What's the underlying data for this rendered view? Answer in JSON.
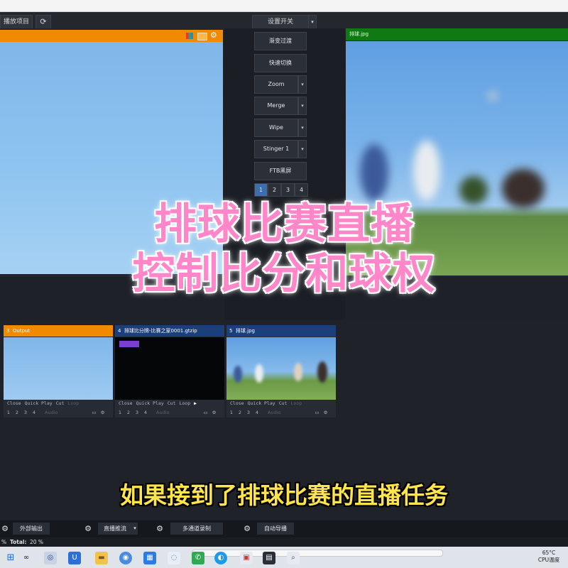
{
  "toolbar": {
    "left_label": "播放项目",
    "refresh_icon": "refresh-icon",
    "center_select": "设置开关",
    "dropdown_icon": "chevron-down-icon"
  },
  "preview": {
    "icons": [
      "color-bars-icon",
      "grid-icon",
      "gear-icon"
    ]
  },
  "transitions": {
    "buttons": [
      {
        "label": "渐变过渡",
        "has_dropdown": false
      },
      {
        "label": "快速切换",
        "has_dropdown": false
      },
      {
        "label": "Zoom",
        "has_dropdown": true
      },
      {
        "label": "Merge",
        "has_dropdown": true
      },
      {
        "label": "Wipe",
        "has_dropdown": true
      },
      {
        "label": "Stinger 1",
        "has_dropdown": true
      },
      {
        "label": "FTB黑屏",
        "has_dropdown": false
      }
    ],
    "pages": [
      "1",
      "2",
      "3",
      "4"
    ],
    "active_page": "1"
  },
  "program": {
    "header": "排球.jpg"
  },
  "overlay": {
    "title_line1": "排球比赛直播",
    "title_line2": "控制比分和球权",
    "subtitle": "如果接到了排球比赛的直播任务"
  },
  "inputs": [
    {
      "number": "3",
      "name": "Output",
      "header_color": "#f28a00"
    },
    {
      "number": "4",
      "name": "排球比分牌-比赛之家0001.gtzip",
      "header_color": "#1b3f7a"
    },
    {
      "number": "5",
      "name": "排球.jpg",
      "header_color": "#1b3f7a"
    }
  ],
  "input_controls": {
    "labels": [
      "Close",
      "Quick Play",
      "Cut",
      "Loop"
    ],
    "numbers": [
      "1",
      "2",
      "3",
      "4"
    ],
    "audio_label": "Audio"
  },
  "bottom_bar": {
    "buttons": [
      "外部输出",
      "直播推流",
      "多通道录制",
      "自动导播"
    ]
  },
  "status": {
    "left_value": "%",
    "total_label": "Total:",
    "total_value": "20 %",
    "temp": "65°C",
    "temp_label": "CPU温度"
  },
  "taskbar": {
    "icons": [
      "windows-icon",
      "search-icon",
      "task-view-icon",
      "app-u-icon",
      "file-explorer-icon",
      "chrome-icon",
      "vmix-icon",
      "wechat-icon",
      "app-icon",
      "edge-icon",
      "store-icon",
      "app2-icon",
      "app3-icon"
    ]
  }
}
